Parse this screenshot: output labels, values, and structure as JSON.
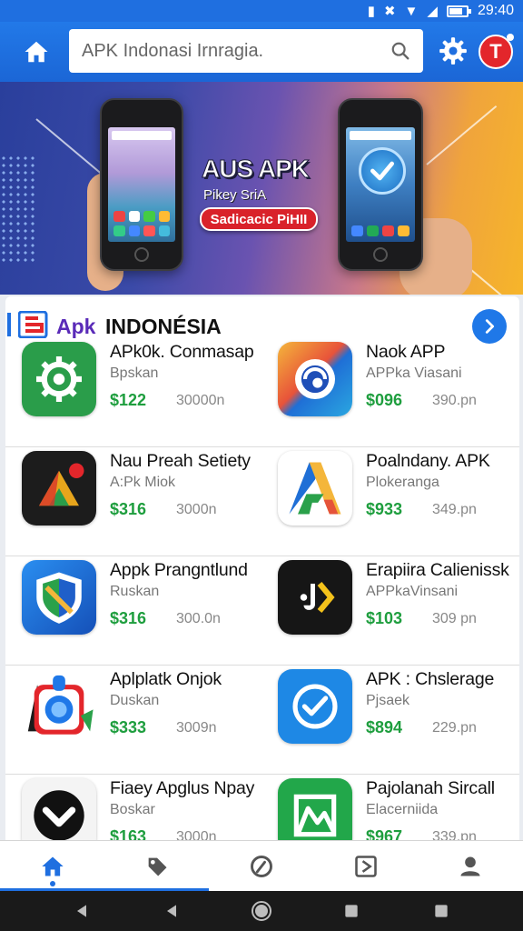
{
  "status_bar": {
    "time": "29:40",
    "icons": [
      "vibrate-icon",
      "bluetooth-icon",
      "wifi-icon",
      "signal-icon",
      "battery-icon"
    ]
  },
  "app_bar": {
    "search": {
      "placeholder": "APK Indonasi Irnragia."
    },
    "icons": [
      "home-icon",
      "search-icon",
      "gear-icon",
      "notification-icon"
    ],
    "notification_glyph": "T"
  },
  "banner": {
    "title": "AUS APK",
    "subtitle": "Pikey SriA",
    "cta_label": "Sadicacic PiHII"
  },
  "section": {
    "brand": "Apk",
    "title": "INDONÉSIA"
  },
  "apps": [
    {
      "name": "APk0k. Conmasap",
      "developer": "Bpskan",
      "price": "$122",
      "size": "30000n",
      "icon": "gear-shield-icon",
      "icon_bg": "#2a9d4a"
    },
    {
      "name": "Naok APP",
      "developer": "APPka Viasani",
      "price": "$096",
      "size": "390.pn",
      "icon": "swirl-icon",
      "icon_bg": "#1f6fd6"
    },
    {
      "name": "Nau Preah Setiety",
      "developer": "A:Pk Miok",
      "price": "$316",
      "size": "3000n",
      "icon": "triangle-badge-icon",
      "icon_bg": "#1c1c1c"
    },
    {
      "name": "Poalndany. APK",
      "developer": "Plokeranga",
      "price": "$933",
      "size": "349.pn",
      "icon": "letter-a-icon",
      "icon_bg": "#ffffff"
    },
    {
      "name": "Appk Prangntlund",
      "developer": "Ruskan",
      "price": "$316",
      "size": "300.0n",
      "icon": "shield-icon",
      "icon_bg": "#1d6fd6"
    },
    {
      "name": "Erapiira Calienissk",
      "developer": "APPkaVinsani",
      "price": "$103",
      "size": "309 pn",
      "icon": "music-chevron-icon",
      "icon_bg": "#161616"
    },
    {
      "name": "Aplplatk Onjok",
      "developer": "Duskan",
      "price": "$333",
      "size": "3009n",
      "icon": "camera-icon",
      "icon_bg": "#ffffff"
    },
    {
      "name": "APK : Chslerage",
      "developer": "Pjsaek",
      "price": "$894",
      "size": "229.pn",
      "icon": "check-circle-icon",
      "icon_bg": "#1e88e5"
    },
    {
      "name": "Fiaey Apglus Npay",
      "developer": "Boskar",
      "price": "$163",
      "size": "3000n",
      "icon": "chevron-down-icon",
      "icon_bg": "#f4f4f4"
    },
    {
      "name": "Pajolanah Sircall",
      "developer": "Elacerniida",
      "price": "$967",
      "size": "339.pn",
      "icon": "image-frame-icon",
      "icon_bg": "#22a74a"
    }
  ],
  "bottom_nav": {
    "items": [
      "home-icon",
      "tag-icon",
      "gauge-icon",
      "play-box-icon",
      "profile-icon"
    ],
    "active": "home-icon"
  },
  "system_nav": [
    "back-icon",
    "back-icon",
    "home-circle-icon",
    "recent-icon",
    "recent-icon"
  ],
  "colors": {
    "primary": "#1f6fe0",
    "price": "#1e9e3e",
    "banner_cta": "#d9222a",
    "notification": "#e3262b"
  }
}
